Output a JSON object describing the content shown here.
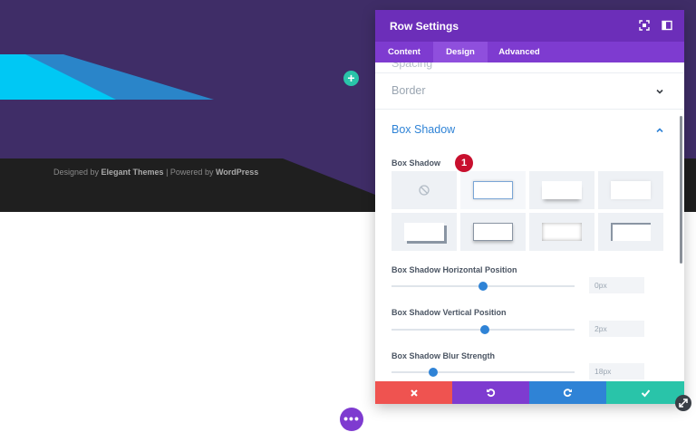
{
  "footer": {
    "designed_by": "Designed by ",
    "elegant": "Elegant Themes",
    "separator": " | Powered by ",
    "wordpress": "WordPress"
  },
  "modal": {
    "title": "Row Settings",
    "tabs": [
      "Content",
      "Design",
      "Advanced"
    ],
    "active_tab": "Design",
    "sections": {
      "border": "Border",
      "box_shadow": "Box Shadow"
    },
    "box_shadow_label": "Box Shadow",
    "badge": "1",
    "fields": [
      {
        "label": "Box Shadow Horizontal Position",
        "value": "0px",
        "level": 0.5
      },
      {
        "label": "Box Shadow Vertical Position",
        "value": "2px",
        "level": 0.51
      },
      {
        "label": "Box Shadow Blur Strength",
        "value": "18px",
        "level": 0.23
      }
    ]
  },
  "colors": {
    "hero": "#3f2d67",
    "header": "#6c2eb9",
    "tabs": "#7e3bd0",
    "accent": "#2f83d6",
    "cancel": "#ef5350",
    "undo": "#7e3bd0",
    "redo": "#2f83d6",
    "save": "#29c4a9"
  }
}
